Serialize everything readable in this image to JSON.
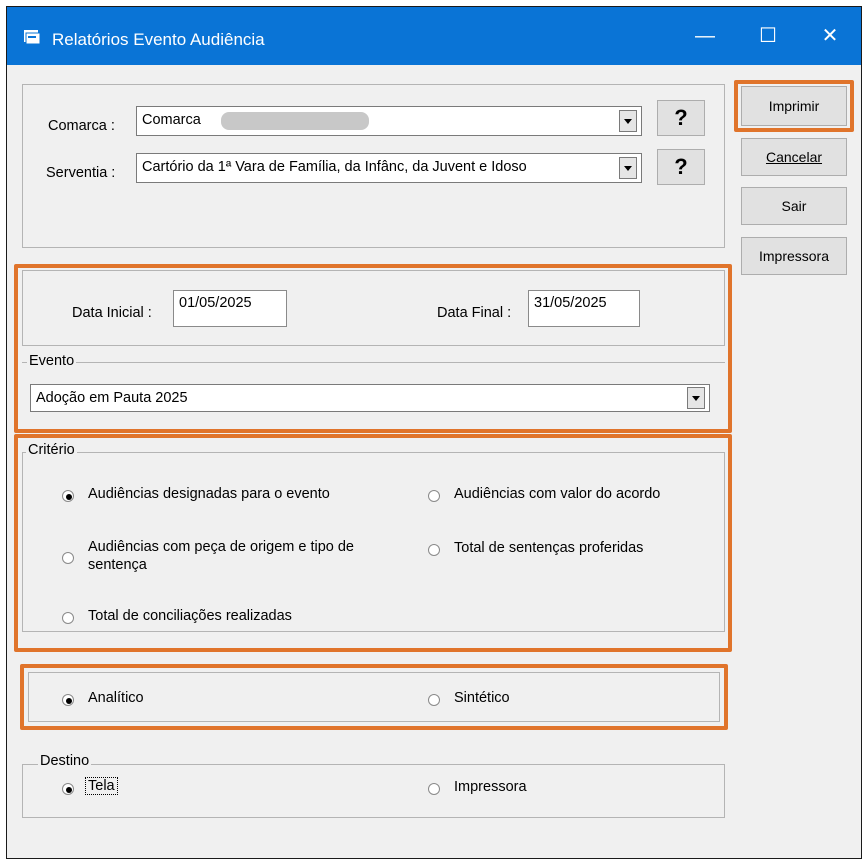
{
  "window": {
    "title": "Relatórios Evento Audiência"
  },
  "titlebar_buttons": {
    "minimize": "—",
    "maximize": "☐",
    "close": "✕"
  },
  "side_buttons": {
    "print": "Imprimir",
    "cancel": "Cancelar",
    "exit": "Sair",
    "printer": "Impressora"
  },
  "location": {
    "comarca_label": "Comarca :",
    "comarca_value": "Comarca",
    "serventia_label": "Serventia :",
    "serventia_value": "Cartório da 1ª Vara de Família, da Infânc, da Juvent e Idoso",
    "help": "?"
  },
  "dates": {
    "start_label": "Data Inicial :",
    "start_value": "01/05/2025",
    "end_label": "Data Final :",
    "end_value": "31/05/2025"
  },
  "event": {
    "legend": "Evento",
    "selected": "Adoção em Pauta 2025"
  },
  "criteria": {
    "legend": "Critério",
    "options": [
      {
        "label": "Audiências designadas para o evento",
        "checked": true
      },
      {
        "label": "Audiências com valor do acordo",
        "checked": false
      },
      {
        "label": "Audiências com peça de origem e tipo de sentença",
        "checked": false
      },
      {
        "label": "Total de sentenças proferidas",
        "checked": false
      },
      {
        "label": "Total de conciliações realizadas",
        "checked": false
      }
    ]
  },
  "report_type": {
    "analytic": "Analítico",
    "synthetic": "Sintético",
    "selected": "Analítico"
  },
  "destination": {
    "legend": "Destino",
    "screen": "Tela",
    "printer": "Impressora",
    "selected": "Tela"
  }
}
